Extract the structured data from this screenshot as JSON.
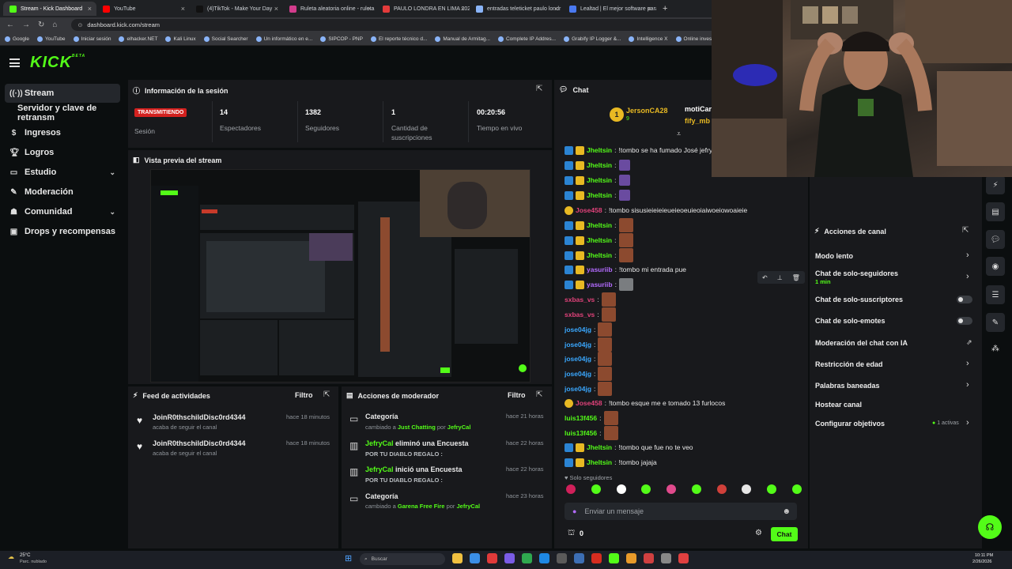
{
  "browser": {
    "tabs": [
      {
        "title": "Stream - Kick Dashboard",
        "color": "#53fc18",
        "active": true
      },
      {
        "title": "YouTube",
        "color": "#ff0000",
        "active": false
      },
      {
        "title": "(4)TikTok - Make Your Day",
        "color": "#111111",
        "active": false
      },
      {
        "title": "Ruleta aleatoria online - ruleta",
        "color": "#d23c8c",
        "active": false
      },
      {
        "title": "PAULO LONDRA EN LIMA 2026",
        "color": "#e33b3b",
        "active": false
      },
      {
        "title": "entradas teleticket paulo londr",
        "color": "#8ab4f8",
        "active": false
      },
      {
        "title": "Lealtad | El mejor software para",
        "color": "#4a79f0",
        "active": false
      }
    ],
    "new_tab": "+",
    "url": "dashboard.kick.com/stream",
    "bookmarks": [
      "Google",
      "YouTube",
      "Iniciar sesión",
      "elhacker.NET",
      "Kali Linux",
      "Social Searcher",
      "Un informático en e...",
      "SIPCOP - PNP",
      "El reporte técnico d...",
      "Manual de Armitag...",
      "Complete IP Addres...",
      "Grabify IP Logger &...",
      "Intelligence X",
      "Online investigation..."
    ]
  },
  "brand": {
    "logo": "KICK",
    "logo_tag": "BETA",
    "accent": "#53fc18"
  },
  "sidebar": {
    "items": [
      {
        "label": "Stream",
        "icon": "broadcast-icon"
      },
      {
        "label": "Servidor y clave de retransm"
      },
      {
        "label": "Ingresos",
        "icon": "dollar-icon"
      },
      {
        "label": "Logros",
        "icon": "trophy-icon"
      },
      {
        "label": "Estudio",
        "icon": "monitor-icon"
      },
      {
        "label": "Moderación",
        "icon": "wrench-icon"
      },
      {
        "label": "Comunidad",
        "icon": "people-icon"
      },
      {
        "label": "Drops y recompensas",
        "icon": "gift-icon"
      }
    ]
  },
  "session": {
    "title": "Información de la sesión",
    "status": "TRANSMITIENDO",
    "status_label": "Sesión",
    "stats": [
      {
        "value": "14",
        "label": "Espectadores"
      },
      {
        "value": "1382",
        "label": "Seguidores"
      },
      {
        "value": "1",
        "label": "Cantidad de suscripciones"
      },
      {
        "value": "00:20:56",
        "label": "Tiempo en vivo"
      }
    ]
  },
  "preview": {
    "title": "Vista previa del stream"
  },
  "feed": {
    "title": "Feed de actividades",
    "filter": "Filtro",
    "items": [
      {
        "name": "JoinR0thschildDisc0rd4344",
        "sub": "acaba de seguir el canal",
        "time": "hace 18 minutos"
      },
      {
        "name": "JoinR0thschildDisc0rd4344",
        "sub": "acaba de seguir el canal",
        "time": "hace 18 minutos"
      }
    ]
  },
  "modactions": {
    "title": "Acciones de moderador",
    "filter": "Filtro",
    "items": [
      {
        "title": "Categoría",
        "line": [
          "cambiado a ",
          "Just Chatting",
          " por ",
          "JefryCal"
        ],
        "time": "hace 21 horas"
      },
      {
        "title_user": "JefryCal",
        "title_rest": " eliminó una Encuesta",
        "sub": "POR TU DIABLO REGALO :",
        "time": "hace 22 horas"
      },
      {
        "title_user": "JefryCal",
        "title_rest": " inició una Encuesta",
        "sub": "POR TU DIABLO REGALO :",
        "time": "hace 22 horas"
      },
      {
        "title": "Categoría",
        "line": [
          "cambiado a ",
          "Garena Free Fire",
          " por ",
          "JefryCal"
        ],
        "time": "hace 23 horas"
      }
    ]
  },
  "chat": {
    "title": "Chat",
    "pinned": {
      "user1": "JersonCA28",
      "count": "9",
      "user2": "motiCarl",
      "user3": "fify_mb",
      "rank": "1"
    },
    "messages": [
      {
        "user": "Jheltsin",
        "color": "#53fc18",
        "text": "!tombo se ha fumado José jefry",
        "badges": "bb"
      },
      {
        "user": "Jheltsin",
        "color": "#53fc18",
        "text": "",
        "emote": "purple",
        "badges": "bb"
      },
      {
        "user": "Jheltsin",
        "color": "#53fc18",
        "text": "",
        "emote": "purple",
        "badges": "bb"
      },
      {
        "user": "Jheltsin",
        "color": "#53fc18",
        "text": "",
        "emote": "purple",
        "badges": "bb"
      },
      {
        "user": "Jose458",
        "color": "#e0427a",
        "text": "!tombo sisusieieieieueieoeuieoiaiwoeiowoaieie",
        "badges": "c"
      },
      {
        "user": "Jheltsin",
        "color": "#53fc18",
        "text": "",
        "emote": "brown",
        "badges": "bb"
      },
      {
        "user": "Jheltsin",
        "color": "#53fc18",
        "text": "",
        "emote": "brown",
        "badges": "bb"
      },
      {
        "user": "Jheltsin",
        "color": "#53fc18",
        "text": "",
        "emote": "brown",
        "badges": "bb"
      },
      {
        "user": "yasuriib",
        "color": "#b36bff",
        "text": "!tombo mi entrada pue",
        "badges": "bb"
      },
      {
        "user": "yasuriib",
        "color": "#b36bff",
        "text": "",
        "emote": "gray",
        "badges": "bb"
      },
      {
        "user": "sxbas_vs",
        "color": "#e0427a",
        "text": "",
        "emote": "brown",
        "badges": ""
      },
      {
        "user": "sxbas_vs",
        "color": "#e0427a",
        "text": "",
        "emote": "brown",
        "badges": ""
      },
      {
        "user": "jose04jg",
        "color": "#3aa8ff",
        "text": "",
        "emote": "brown",
        "badges": ""
      },
      {
        "user": "jose04jg",
        "color": "#3aa8ff",
        "text": "",
        "emote": "brown",
        "badges": ""
      },
      {
        "user": "jose04jg",
        "color": "#3aa8ff",
        "text": "",
        "emote": "brown",
        "badges": ""
      },
      {
        "user": "jose04jg",
        "color": "#3aa8ff",
        "text": "",
        "emote": "brown",
        "badges": ""
      },
      {
        "user": "jose04jg",
        "color": "#3aa8ff",
        "text": "",
        "emote": "brown",
        "badges": ""
      },
      {
        "user": "Jose458",
        "color": "#e0427a",
        "text": "!tombo esque me e tomado 13 furlocos",
        "badges": "c"
      },
      {
        "user": "luis13f456",
        "color": "#53fc18",
        "text": "",
        "emote": "brown",
        "badges": ""
      },
      {
        "user": "luis13f456",
        "color": "#53fc18",
        "text": "",
        "emote": "brown",
        "badges": ""
      },
      {
        "user": "Jheltsin",
        "color": "#53fc18",
        "text": "!tombo que fue no te veo",
        "badges": "bb"
      },
      {
        "user": "Jheltsin",
        "color": "#53fc18",
        "text": "!tombo jajaja",
        "badges": "bb"
      }
    ],
    "followers_only": "Solo seguidores",
    "input_placeholder": "Enviar un mensaje",
    "points": "0",
    "send_label": "Chat"
  },
  "channel_actions": {
    "title": "Acciones de canal",
    "items": [
      {
        "label": "Modo lento",
        "type": "chevron"
      },
      {
        "label": "Chat de solo-seguidores",
        "sub": "1 min",
        "type": "chevron"
      },
      {
        "label": "Chat de solo-suscriptores",
        "type": "toggle"
      },
      {
        "label": "Chat de solo-emotes",
        "type": "toggle"
      },
      {
        "label": "Moderación del chat con IA",
        "type": "external"
      },
      {
        "label": "Restricción de edad",
        "type": "chevron"
      },
      {
        "label": "Palabras baneadas",
        "type": "chevron"
      },
      {
        "label": "Hostear canal",
        "type": "none"
      },
      {
        "label": "Configurar objetivos",
        "badge": "1 activas",
        "type": "chevron"
      }
    ]
  },
  "taskbar": {
    "weather_temp": "25°C",
    "weather_desc": "Parc. nublado",
    "search": "Buscar",
    "time": "10:11 PM",
    "date": "2/26/2026"
  }
}
